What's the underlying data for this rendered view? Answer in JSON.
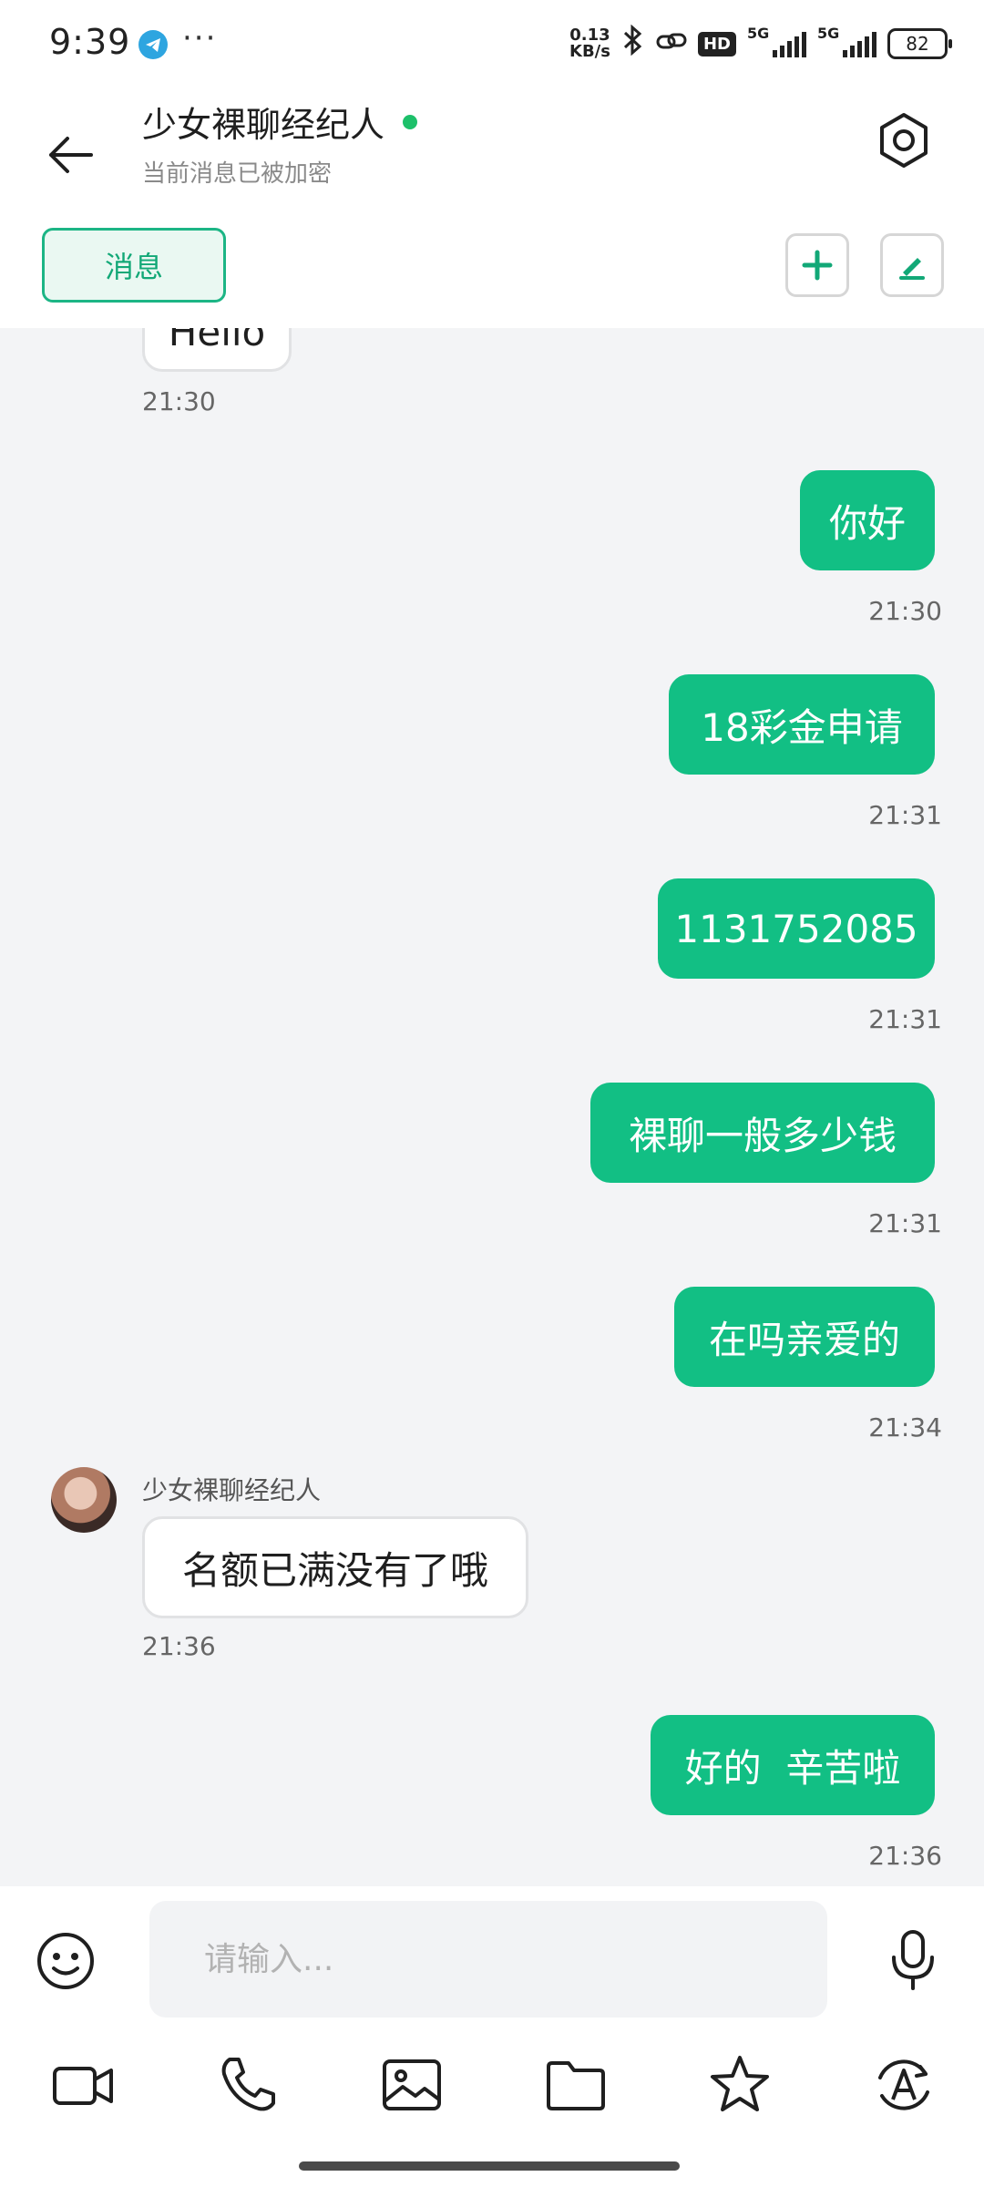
{
  "status_bar": {
    "time": "9:39",
    "dots": "···",
    "speed_value": "0.13",
    "speed_unit": "KB/s",
    "hd_label": "HD",
    "sim1": "5G",
    "sim2": "5G",
    "battery": "82",
    "icons": [
      "telegram-icon",
      "bluetooth-icon",
      "link-icon",
      "signal-icon",
      "battery-icon"
    ]
  },
  "header": {
    "title": "少女裸聊经纪人",
    "subtitle": "当前消息已被加密",
    "tab_label": "消息",
    "online_color": "#1dc06a"
  },
  "messages": [
    {
      "dir": "in",
      "text": "Hello",
      "time": "21:30"
    },
    {
      "dir": "out",
      "text": "你好",
      "time": "21:30"
    },
    {
      "dir": "out",
      "text": "18彩金申请",
      "time": "21:31"
    },
    {
      "dir": "out",
      "text": "1131752085",
      "time": "21:31"
    },
    {
      "dir": "out",
      "text": "裸聊一般多少钱",
      "time": "21:31"
    },
    {
      "dir": "out",
      "text": "在吗亲爱的",
      "time": "21:34"
    },
    {
      "dir": "in",
      "sender": "少女裸聊经纪人",
      "text": "名额已满没有了哦",
      "time": "21:36"
    },
    {
      "dir": "out",
      "text": "好的  辛苦啦",
      "time": "21:36"
    }
  ],
  "composer": {
    "placeholder": "请输入...",
    "value": "",
    "tools": [
      "video-icon",
      "phone-icon",
      "image-icon",
      "folder-icon",
      "star-icon",
      "translate-icon"
    ]
  },
  "colors": {
    "accent": "#12bf84",
    "chat_bg": "#f3f4f6",
    "tab_border": "#1cb585"
  }
}
